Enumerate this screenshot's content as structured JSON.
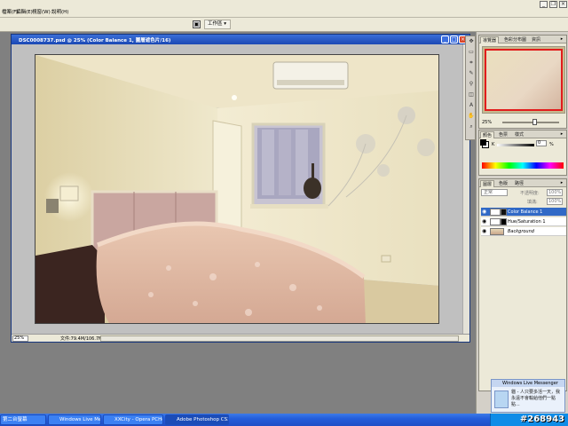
{
  "menubar": {
    "items": [
      "檔案(F)",
      "編輯(E)",
      "視窗(W)",
      "說明(H)"
    ]
  },
  "optionsbar": {
    "workspace_label": "工作區 ▾"
  },
  "document": {
    "title": "DSC0008737.psd @ 25% (Color Balance 1, 圖層遮色片/16)",
    "zoom": "25%",
    "doc_info": "文件:79.4M/106.7M"
  },
  "panels": {
    "navigator_tabs": [
      "導覽器",
      "色彩分布圖",
      "資訊"
    ],
    "navigator_zoom": "25%",
    "color_tabs": [
      "顏色",
      "色票",
      "樣式"
    ],
    "color_k_label": "K",
    "color_k_value": "0",
    "color_k_unit": "%",
    "layers_tabs": [
      "圖層",
      "色版",
      "路徑"
    ],
    "blend_mode": "正常",
    "opacity_label": "不透明度:",
    "opacity_value": "100%",
    "fill_label": "填滿:",
    "fill_value": "100%",
    "layers": [
      {
        "name": "Color Balance 1",
        "selected": true
      },
      {
        "name": "Hue/Saturation 1",
        "selected": false
      },
      {
        "name": "Background",
        "selected": false
      }
    ]
  },
  "messenger": {
    "title": "Windows Live Messenger",
    "text": "貓 - 人只要多活一天，我永遠不會輸給他們一點點..."
  },
  "taskbar": {
    "buttons": [
      "第二台螢幕",
      "Windows Live Messen...",
      "XXCity - Opera PCHo...",
      "Adobe Photoshop CS3..."
    ],
    "watermark": "#268943"
  }
}
